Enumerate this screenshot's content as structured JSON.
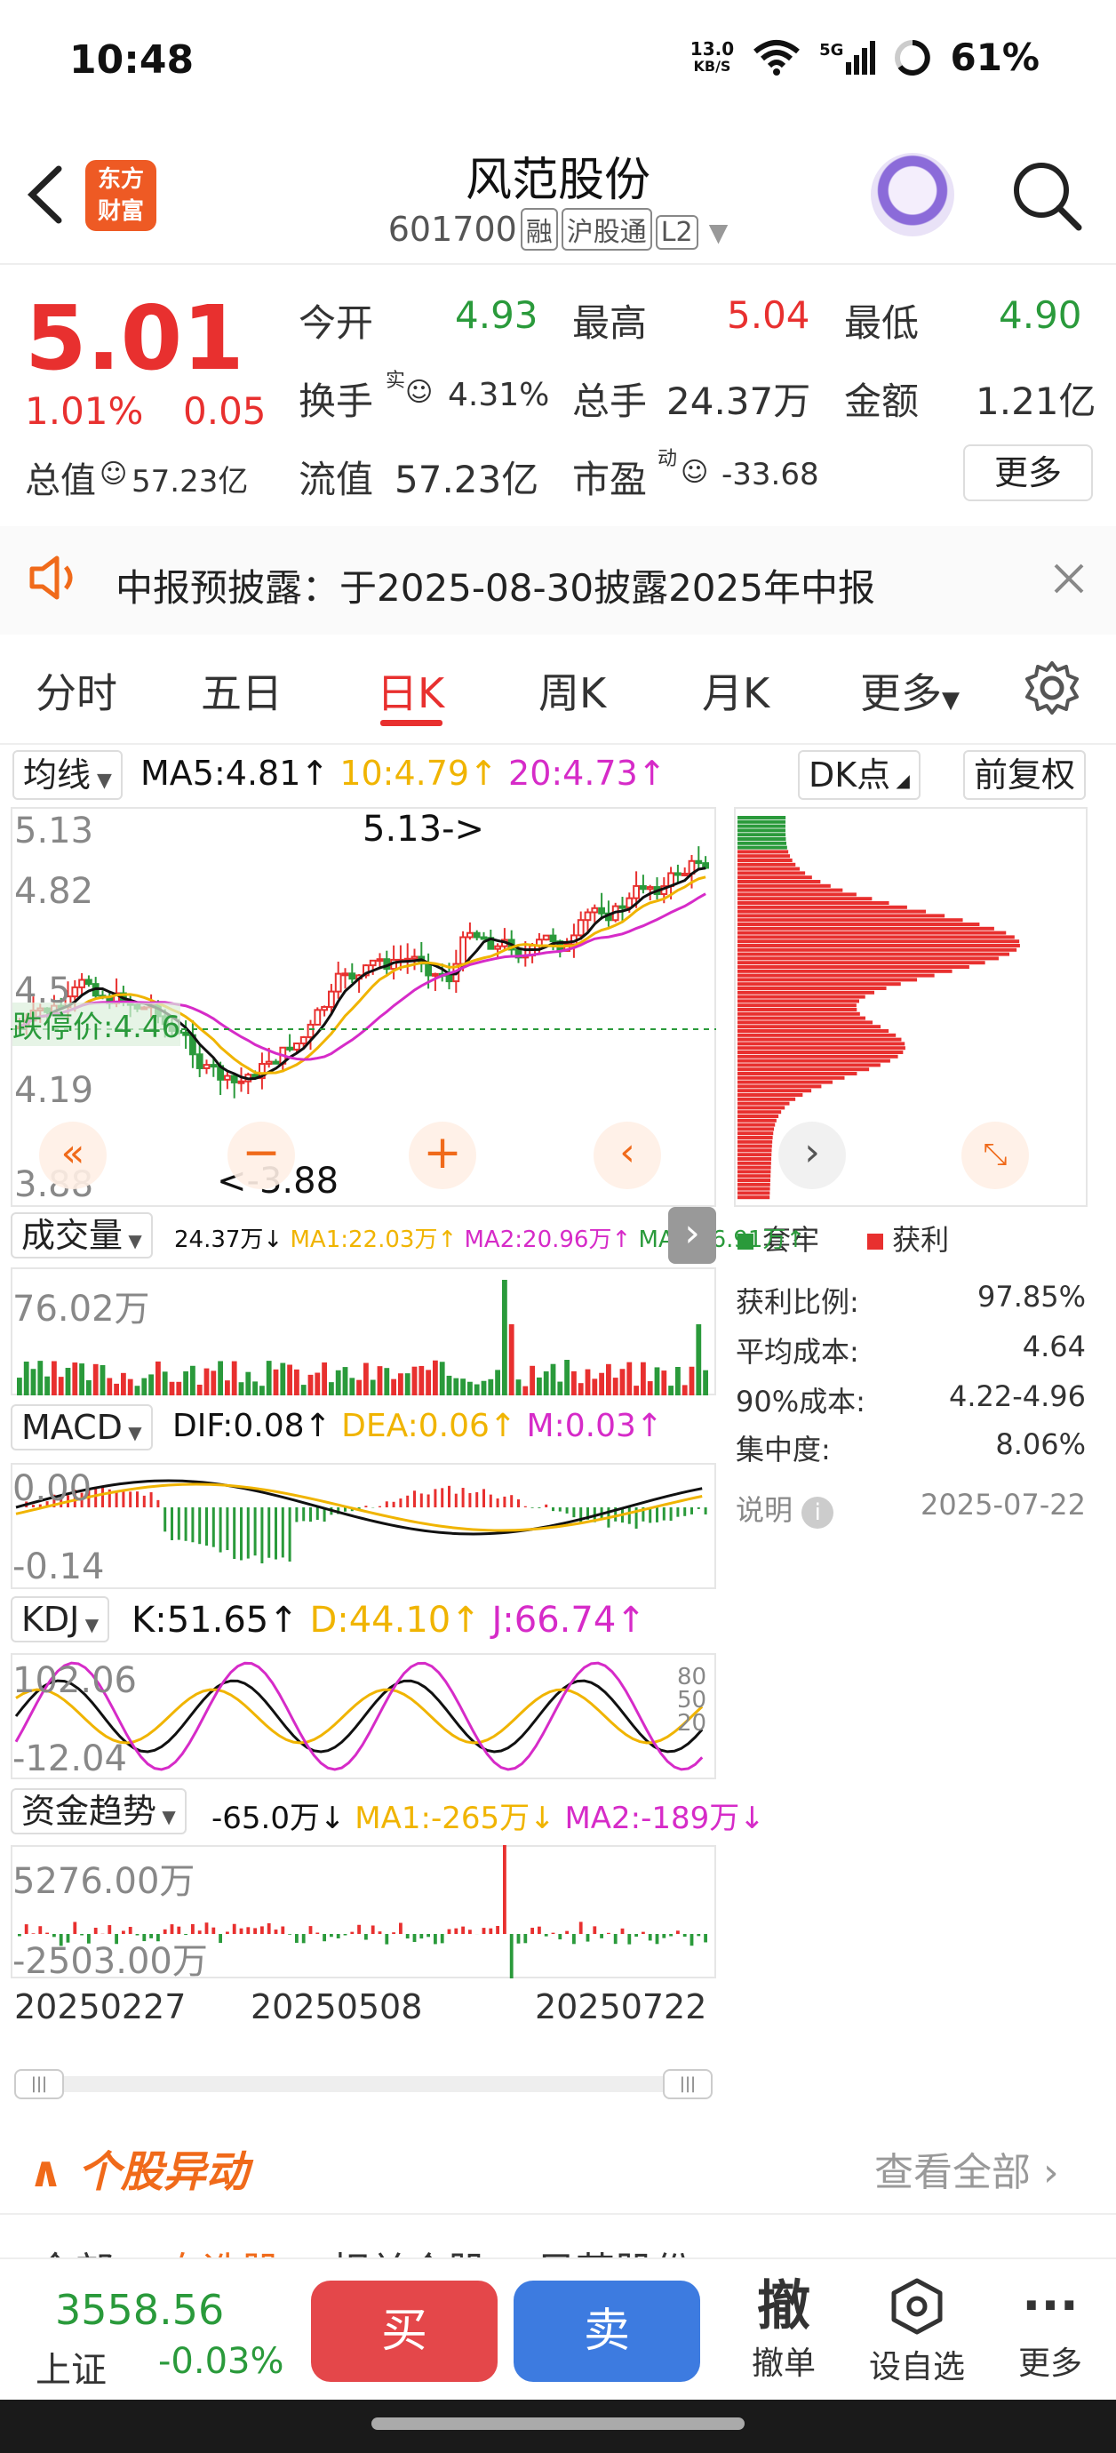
{
  "status_bar": {
    "time": "10:48",
    "net_speed_value": "13.0",
    "net_speed_unit": "KB/S",
    "signal_label": "5G",
    "battery": "61%"
  },
  "header": {
    "title": "风范股份",
    "code": "601700",
    "tags": [
      "融",
      "沪股通",
      "L2"
    ],
    "logo_text_line1": "东方",
    "logo_text_line2": "财富"
  },
  "quote": {
    "price": "5.01",
    "change_pct": "1.01%",
    "change_amt": "0.05",
    "open_label": "今开",
    "open": "4.93",
    "high_label": "最高",
    "high": "5.04",
    "low_label": "最低",
    "low": "4.90",
    "turnover_label": "换手",
    "turnover_sup": "实",
    "turnover": "4.31%",
    "volume_label": "总手",
    "volume": "24.37万",
    "amount_label": "金额",
    "amount": "1.21亿",
    "mktcap_label": "总值",
    "mktcap": "57.23亿",
    "float_label": "流值",
    "float": "57.23亿",
    "pe_label": "市盈",
    "pe_sup": "动",
    "pe": "-33.68",
    "more_label": "更多"
  },
  "notice": {
    "text": "中报预披露：于2025-08-30披露2025年中报"
  },
  "tabs": [
    "分时",
    "五日",
    "日K",
    "周K",
    "月K",
    "更多"
  ],
  "active_tab": "日K",
  "kline": {
    "indicator_label": "均线",
    "ma5": "MA5:4.81↑",
    "ma10": "10:4.79↑",
    "ma20": "20:4.73↑",
    "dk_label": "DK点",
    "adjust_label": "前复权",
    "y_labels": [
      "5.13",
      "4.82",
      "4.5",
      "4.19",
      "3.88"
    ],
    "max_annot": "5.13->",
    "min_annot": "<-3.88",
    "limit_label": "跌停价:4.46",
    "colors": {
      "up": "#e8302f",
      "down": "#2a9a3b",
      "ma5": "#111111",
      "ma10": "#f0b400",
      "ma20": "#d62bc8"
    }
  },
  "cost_distribution": {
    "legend_trapped": "套牢",
    "legend_profit": "获利",
    "profit_ratio_label": "获利比例:",
    "profit_ratio": "97.85%",
    "avg_cost_label": "平均成本:",
    "avg_cost": "4.64",
    "cost90_label": "90%成本:",
    "cost90": "4.22-4.96",
    "concentration_label": "集中度:",
    "concentration": "8.06%",
    "note_label": "说明",
    "date": "2025-07-22"
  },
  "volume_panel": {
    "label": "成交量",
    "values": "24.37万↓",
    "ma1": "MA1:22.03万↑",
    "ma2": "MA2:20.96万↑",
    "ma3": "MA3:16.91万↑",
    "max_label": "76.02万"
  },
  "macd_panel": {
    "label": "MACD",
    "dif": "DIF:0.08↑",
    "dea": "DEA:0.06↑",
    "m": "M:0.03↑",
    "top_label": "0.00",
    "bottom_label": "-0.14"
  },
  "kdj_panel": {
    "label": "KDJ",
    "k": "K:51.65↑",
    "d": "D:44.10↑",
    "j": "J:66.74↑",
    "top_label": "102.06",
    "bottom_label": "-12.04",
    "right_labels": [
      "80",
      "50",
      "20"
    ]
  },
  "fund_panel": {
    "label": "资金趋势",
    "value": "-65.0万↓",
    "ma1": "MA1:-265万↓",
    "ma2": "MA2:-189万↓",
    "top_label": "5276.00万",
    "bottom_label": "-2503.00万"
  },
  "dates": [
    "20250227",
    "20250508",
    "20250722"
  ],
  "movement": {
    "title": "个股异动",
    "view_all": "查看全部"
  },
  "bottom": {
    "index_value": "3558.56",
    "index_name": "上证",
    "index_change": "-0.03%",
    "buy": "买",
    "sell": "卖",
    "cancel_label": "撤单",
    "cancel_glyph": "撤",
    "watch_label": "设自选",
    "more_label": "更多",
    "peek_tabs": [
      "全部",
      "自选股",
      "相关个股",
      "风范股份"
    ]
  }
}
